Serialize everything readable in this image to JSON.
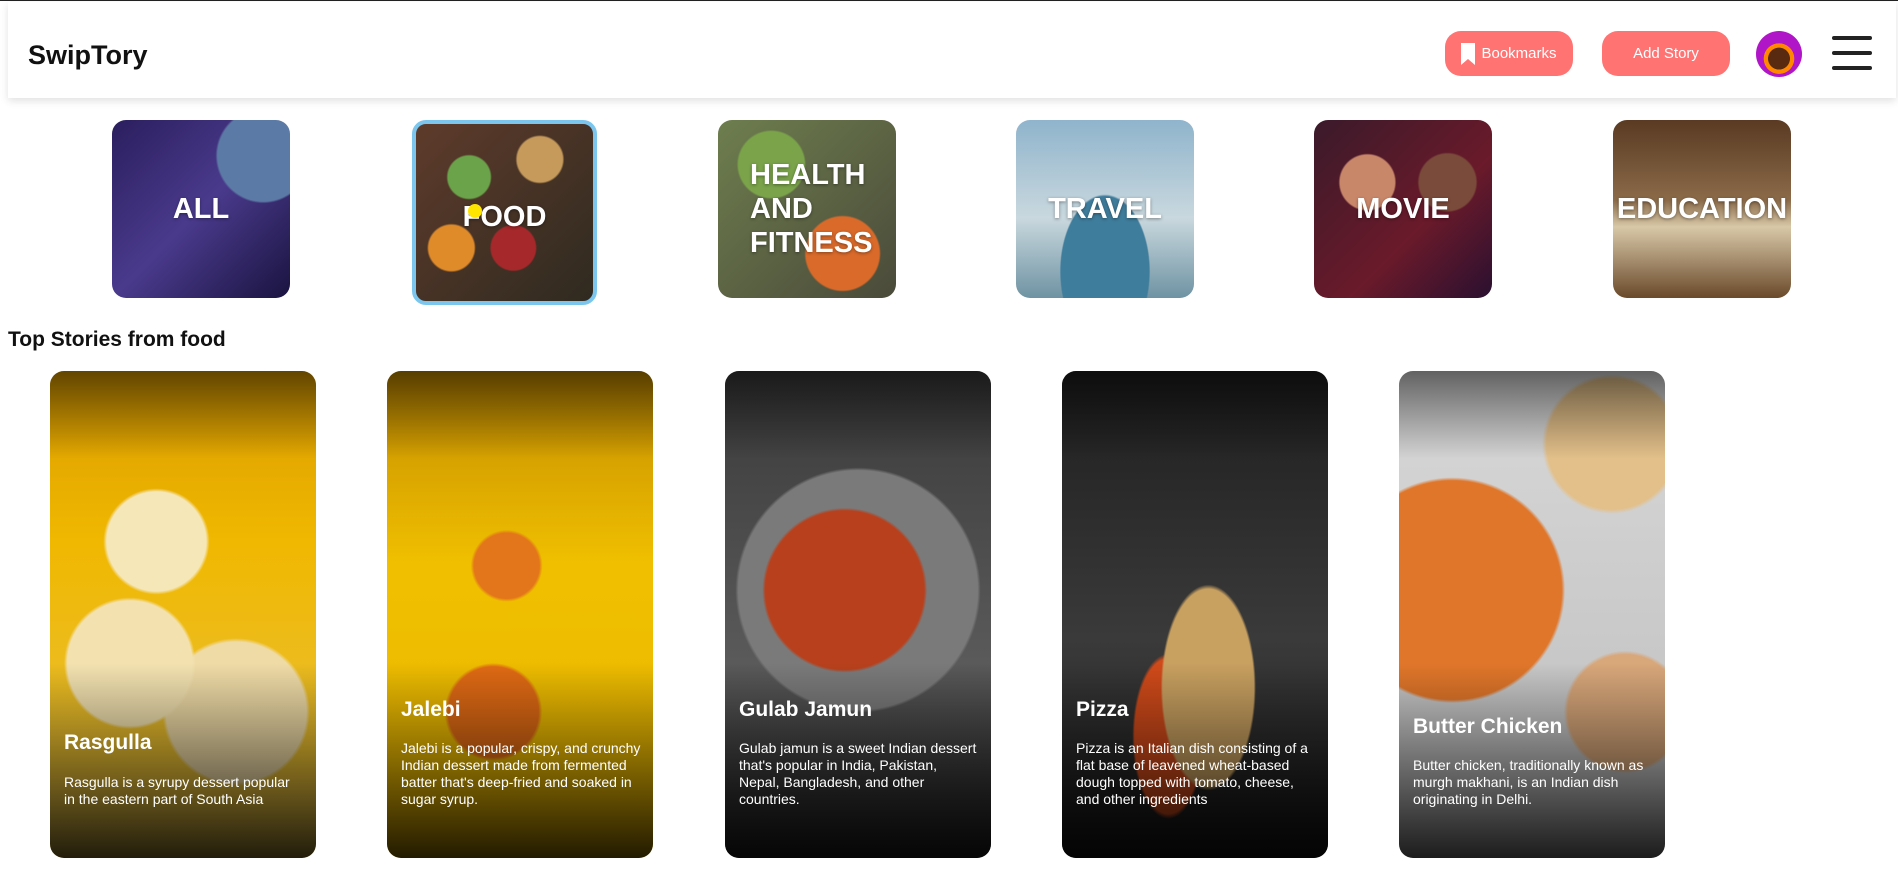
{
  "header": {
    "logo": "SwipTory",
    "bookmarks_label": "Bookmarks",
    "add_story_label": "Add Story"
  },
  "categories": [
    {
      "label": "ALL"
    },
    {
      "label": "FOOD",
      "selected": true
    },
    {
      "label": "HEALTH AND FITNESS"
    },
    {
      "label": "TRAVEL"
    },
    {
      "label": "MOVIE"
    },
    {
      "label": "EDUCATION"
    }
  ],
  "section": {
    "title": "Top Stories from food"
  },
  "stories": [
    {
      "title": "Rasgulla",
      "description": "Rasgulla is a syrupy dessert popular in the eastern part of South Asia"
    },
    {
      "title": "Jalebi",
      "description": "Jalebi is a popular, crispy, and crunchy Indian dessert made from fermented batter that's deep-fried and soaked in sugar syrup."
    },
    {
      "title": "Gulab Jamun",
      "description": "Gulab jamun is a sweet Indian dessert that's popular in India, Pakistan, Nepal, Bangladesh, and other countries."
    },
    {
      "title": "Pizza",
      "description": "Pizza is an Italian dish consisting of a flat base of leavened wheat-based dough topped with tomato, cheese, and other ingredients"
    },
    {
      "title": "Butter Chicken",
      "description": "Butter chicken, traditionally known as murgh makhani, is an Indian dish originating in Delhi."
    }
  ],
  "colors": {
    "accent": "#ff7373",
    "selected_border": "#7cc6ee"
  },
  "icons": [
    "bookmark-icon",
    "menu-icon"
  ]
}
